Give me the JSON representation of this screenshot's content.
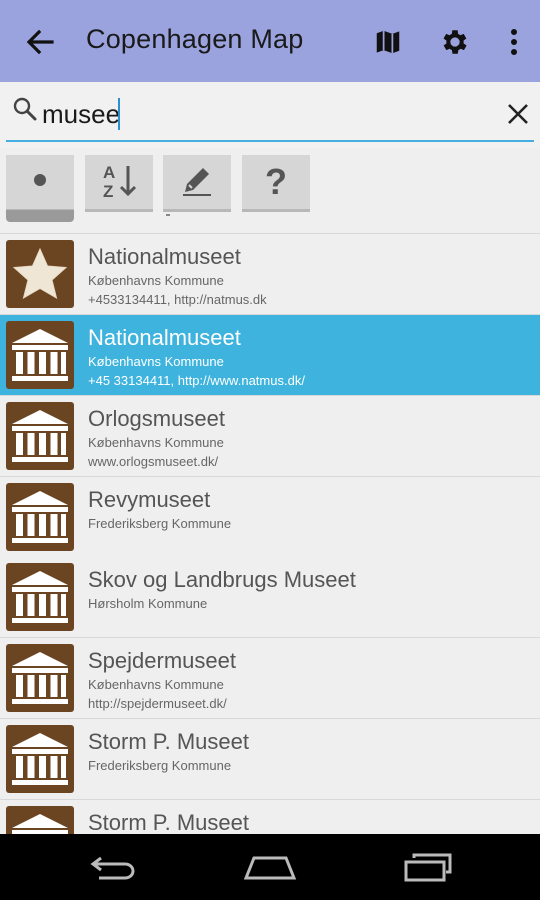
{
  "appbar": {
    "title": "Copenhagen Map",
    "background": "#9aa3de",
    "actions": [
      "map-icon",
      "gear-icon",
      "overflow-menu-icon"
    ]
  },
  "search": {
    "value": "musee",
    "placeholder": ""
  },
  "toolbar": {
    "buttons": [
      {
        "icon": "dot-icon"
      },
      {
        "icon": "sort-az-icon"
      },
      {
        "icon": "edit-icon"
      },
      {
        "icon": "help-icon",
        "label": "?"
      }
    ]
  },
  "results": [
    {
      "name": "Nationalmuseet",
      "line1": "Københavns Kommune",
      "line2": "+4533134411, http://natmus.dk",
      "icon": "star-icon",
      "selected": false
    },
    {
      "name": "Nationalmuseet",
      "line1": "Københavns Kommune",
      "line2": "+45 33134411, http://www.natmus.dk/",
      "icon": "museum-icon",
      "selected": true
    },
    {
      "name": "Orlogsmuseet",
      "line1": "Københavns Kommune",
      "line2": "www.orlogsmuseet.dk/",
      "icon": "museum-icon",
      "selected": false
    },
    {
      "name": "Revymuseet",
      "line1": "Frederiksberg Kommune",
      "line2": "",
      "icon": "museum-icon",
      "selected": false
    },
    {
      "name": "Skov og Landbrugs Museet",
      "line1": "Hørsholm Kommune",
      "line2": "",
      "icon": "museum-icon",
      "selected": false
    },
    {
      "name": "Spejdermuseet",
      "line1": "Københavns Kommune",
      "line2": "http://spejdermuseet.dk/",
      "icon": "museum-icon",
      "selected": false
    },
    {
      "name": "Storm P. Museet",
      "line1": "Frederiksberg Kommune",
      "line2": "",
      "icon": "museum-icon",
      "selected": false
    },
    {
      "name": "Storm P. Museet",
      "line1": "",
      "line2": "",
      "icon": "museum-icon",
      "selected": false
    }
  ],
  "colors": {
    "selected_row": "#3db3dd",
    "icon_brown": "#6b4521",
    "search_underline": "#44aee0"
  },
  "navbar": {
    "buttons": [
      "back-nav-icon",
      "home-nav-icon",
      "recents-nav-icon"
    ]
  }
}
